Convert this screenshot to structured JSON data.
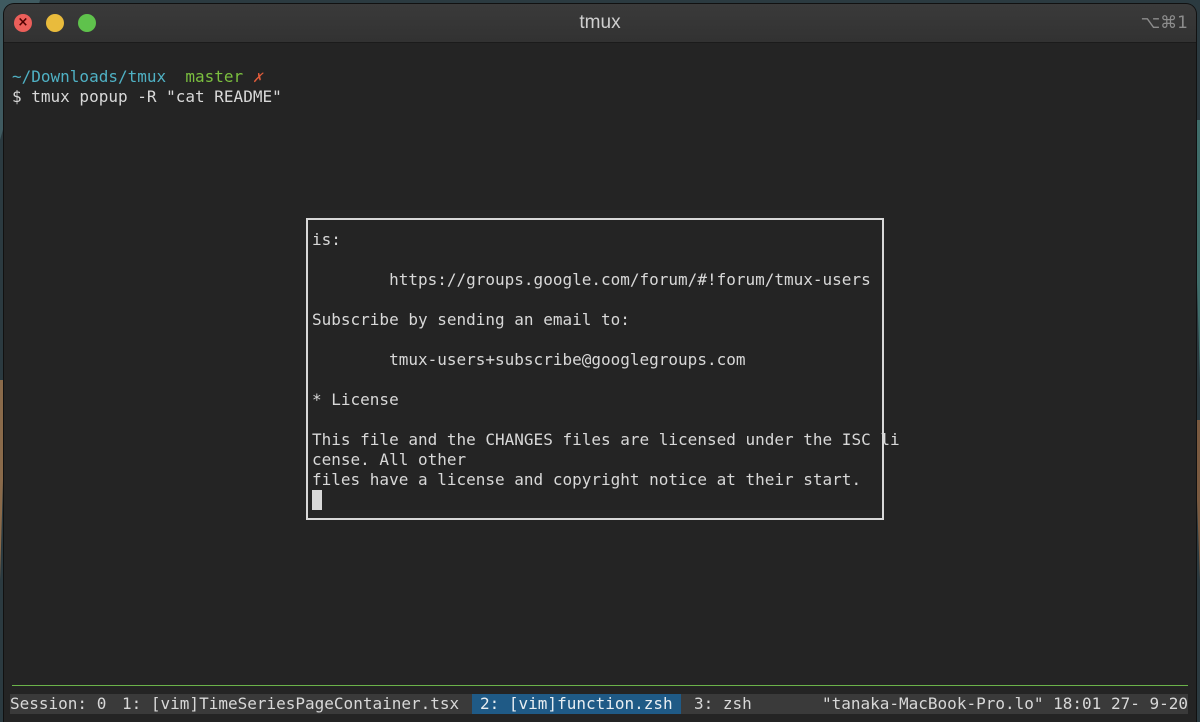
{
  "window": {
    "title": "tmux",
    "shortcut": "⌥⌘1"
  },
  "prompt": {
    "path": "~/Downloads/tmux",
    "branch": "master",
    "dirty_mark": "✗",
    "command": "$ tmux popup -R \"cat README\""
  },
  "popup": {
    "lines": [
      "is:",
      "",
      "        https://groups.google.com/forum/#!forum/tmux-users",
      "",
      "Subscribe by sending an email to:",
      "",
      "        tmux-users+subscribe@googlegroups.com",
      "",
      "* License",
      "",
      "This file and the CHANGES files are licensed under the ISC li",
      "cense. All other",
      "files have a license and copyright notice at their start."
    ]
  },
  "statusbar": {
    "session": "Session: 0",
    "windows": [
      "1: [vim]TimeSeriesPageContainer.tsx",
      "2: [vim]function.zsh",
      "3: zsh"
    ],
    "active_index": 1,
    "right": "\"tanaka-MacBook-Pro.lo\" 18:01 27- 9-20"
  },
  "colors": {
    "path": "#4fb1c4",
    "branch": "#7bbf3f",
    "dirty": "#e25c3a",
    "active_window_bg": "#1f5a86",
    "separator": "#6bb34a"
  }
}
